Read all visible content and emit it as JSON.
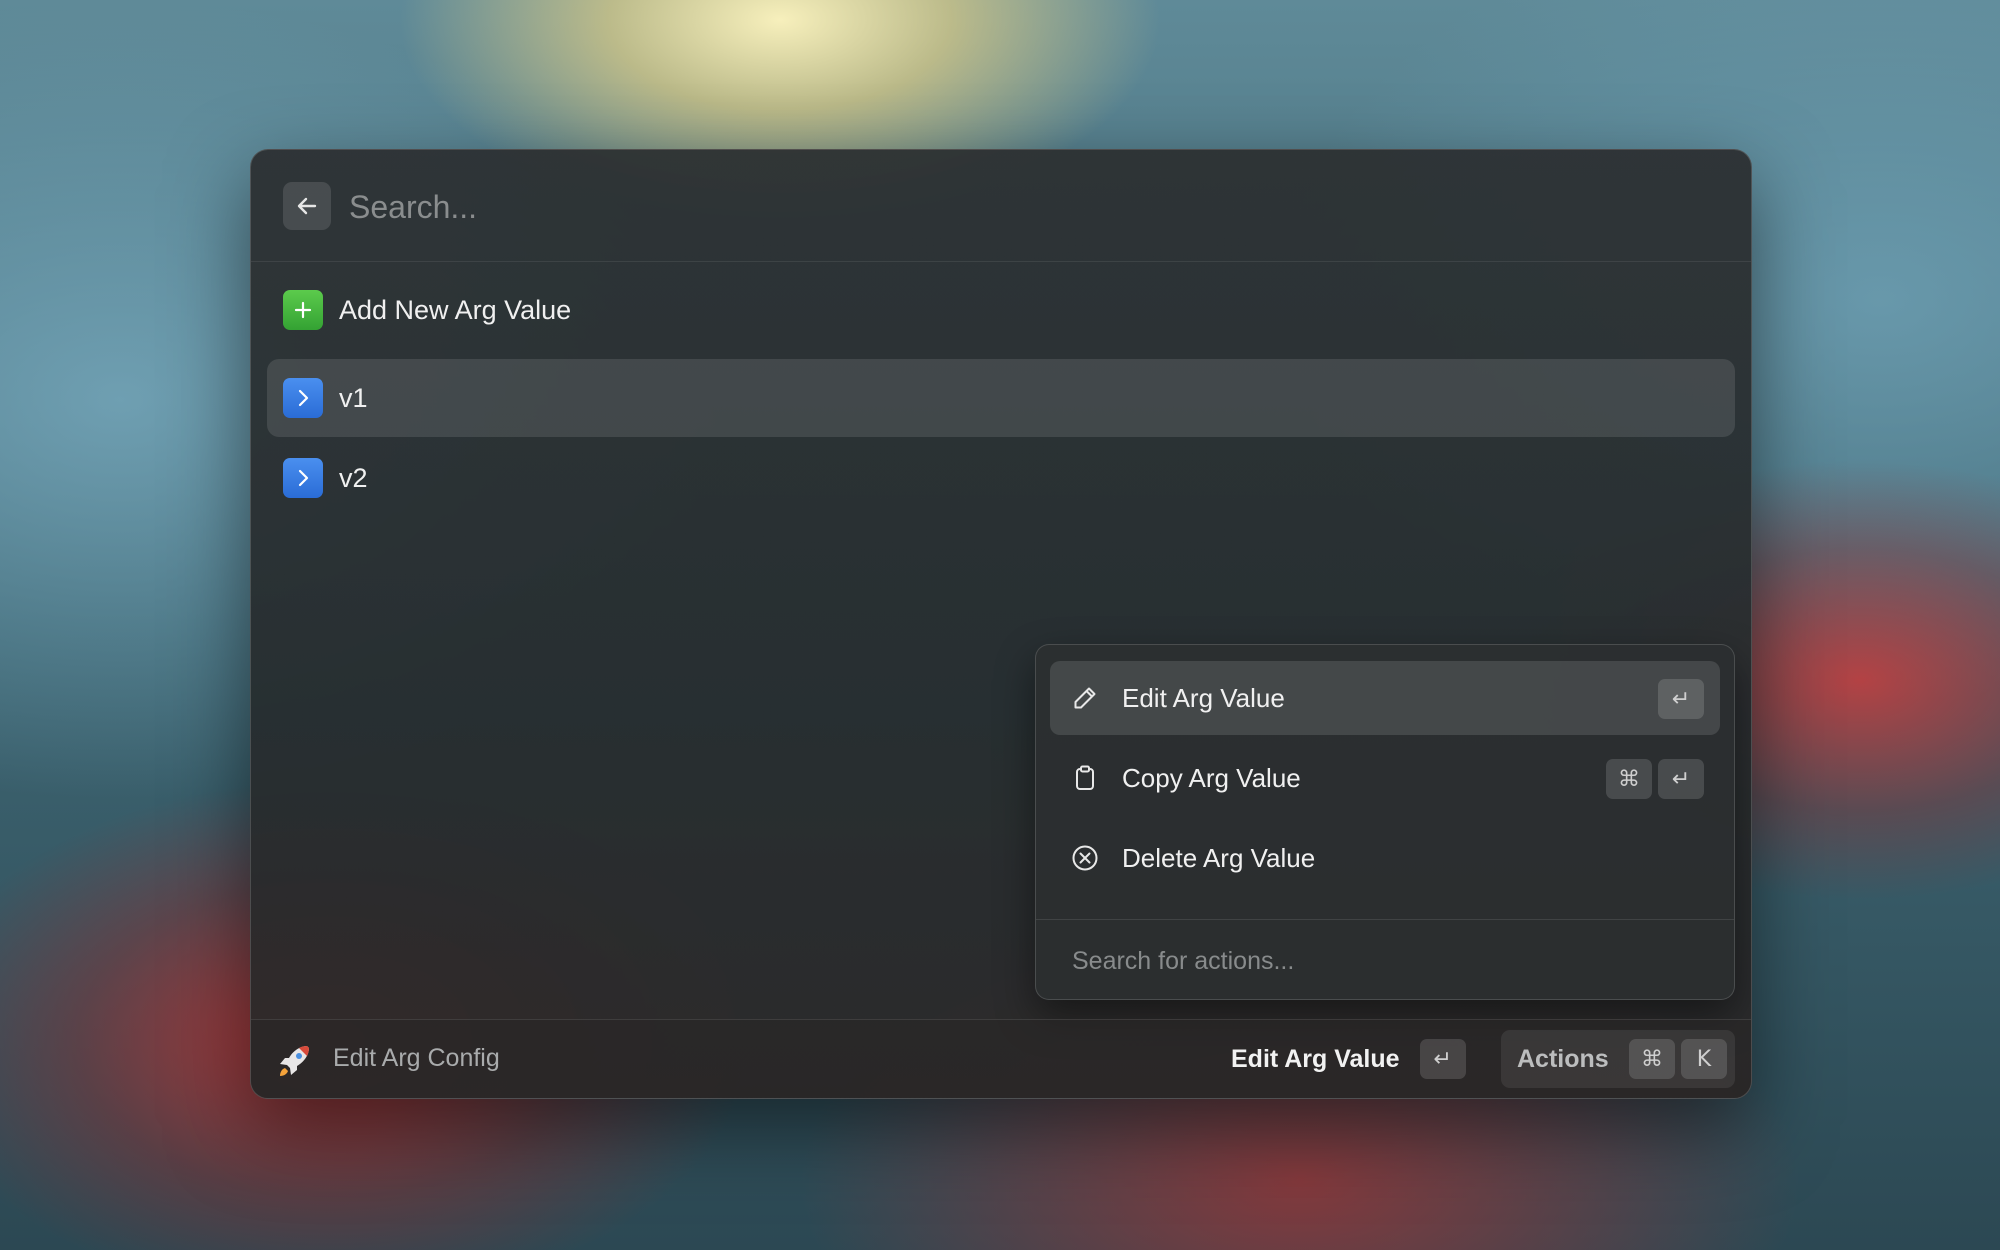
{
  "search": {
    "placeholder": "Search..."
  },
  "list": {
    "items": [
      {
        "label": "Add New Arg Value",
        "icon": "plus-icon",
        "icon_color": "#3fb03a",
        "selected": false
      },
      {
        "label": "v1",
        "icon": "chevron-right-icon",
        "icon_color": "#3479e0",
        "selected": true
      },
      {
        "label": "v2",
        "icon": "chevron-right-icon",
        "icon_color": "#3479e0",
        "selected": false
      }
    ]
  },
  "action_panel": {
    "items": [
      {
        "label": "Edit Arg Value",
        "icon": "pencil-icon",
        "shortcut": [
          "↵"
        ],
        "selected": true
      },
      {
        "label": "Copy Arg Value",
        "icon": "clipboard-icon",
        "shortcut": [
          "⌘",
          "↵"
        ],
        "selected": false
      },
      {
        "label": "Delete Arg Value",
        "icon": "x-circle-icon",
        "shortcut": [],
        "selected": false
      }
    ],
    "search_placeholder": "Search for actions..."
  },
  "footer": {
    "title": "Edit Arg Config",
    "app_icon": "rocket-icon",
    "primary_action": "Edit Arg Value",
    "primary_action_key": "↵",
    "actions_label": "Actions",
    "actions_keys": [
      "⌘",
      "K"
    ]
  },
  "colors": {
    "window_bg": "#2b2f31",
    "selection": "#4a4e50",
    "accent_green": "#3fb03a",
    "accent_blue": "#3479e0"
  }
}
